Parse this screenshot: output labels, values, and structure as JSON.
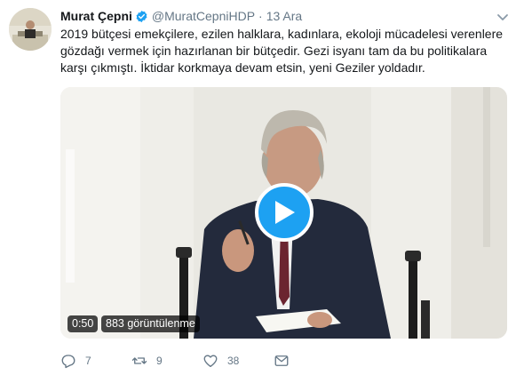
{
  "tweet": {
    "author_name": "Murat Çepni",
    "handle": "@MuratCepniHDP",
    "separator": "·",
    "timestamp": "13 Ara",
    "verified": true,
    "text": "2019 bütçesi emekçilere, ezilen halklara, kadınlara, ekoloji mücadelesi verenlere gözdağı vermek için hazırlanan bir bütçedir. Gezi isyanı tam da bu politikalara karşı çıkmıştı. İktidar korkmaya devam etsin, yeni Geziler yoldadır."
  },
  "video": {
    "duration": "0:50",
    "views": "883 görüntülenme"
  },
  "actions": {
    "reply_count": "7",
    "retweet_count": "9",
    "like_count": "38"
  },
  "icons": [
    "verified-badge-icon",
    "chevron-down-icon",
    "play-icon",
    "reply-icon",
    "retweet-icon",
    "like-icon",
    "message-icon"
  ],
  "colors": {
    "accent": "#1da1f2",
    "text": "#14171a",
    "secondary": "#657786"
  }
}
